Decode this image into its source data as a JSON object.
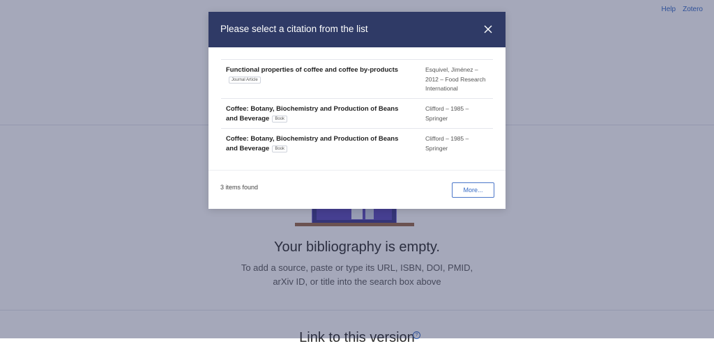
{
  "header_links": {
    "help": "Help",
    "zotero": "Zotero"
  },
  "empty_state": {
    "title": "Your bibliography is empty.",
    "line1": "To add a source, paste or type its URL, ISBN, DOI, PMID,",
    "line2": "arXiv ID, or title into the search box above"
  },
  "section_heading": "Link to this version",
  "help_icon_glyph": "?",
  "modal": {
    "title": "Please select a citation from the list",
    "items": [
      {
        "title": "Functional properties of coffee and coffee by-products",
        "type": "Journal Article",
        "meta_line1": "Esquivel, Jiménez –",
        "meta_line2": "2012 – Food Research",
        "meta_line3": "International"
      },
      {
        "title": "Coffee: Botany, Biochemistry and Production of Beans and Beverage",
        "type": "Book",
        "meta_line1": "Clifford – 1985 –",
        "meta_line2": "Springer"
      },
      {
        "title": "Coffee: Botany, Biochemistry and Production of Beans and Beverage",
        "type": "Book",
        "meta_line1": "Clifford – 1985 –",
        "meta_line2": "Springer"
      }
    ],
    "count_text": "3 items found",
    "more_label": "More..."
  },
  "colors": {
    "modal_header": "#2f3a66",
    "overlay": "#28305a",
    "link": "#3469c4"
  }
}
